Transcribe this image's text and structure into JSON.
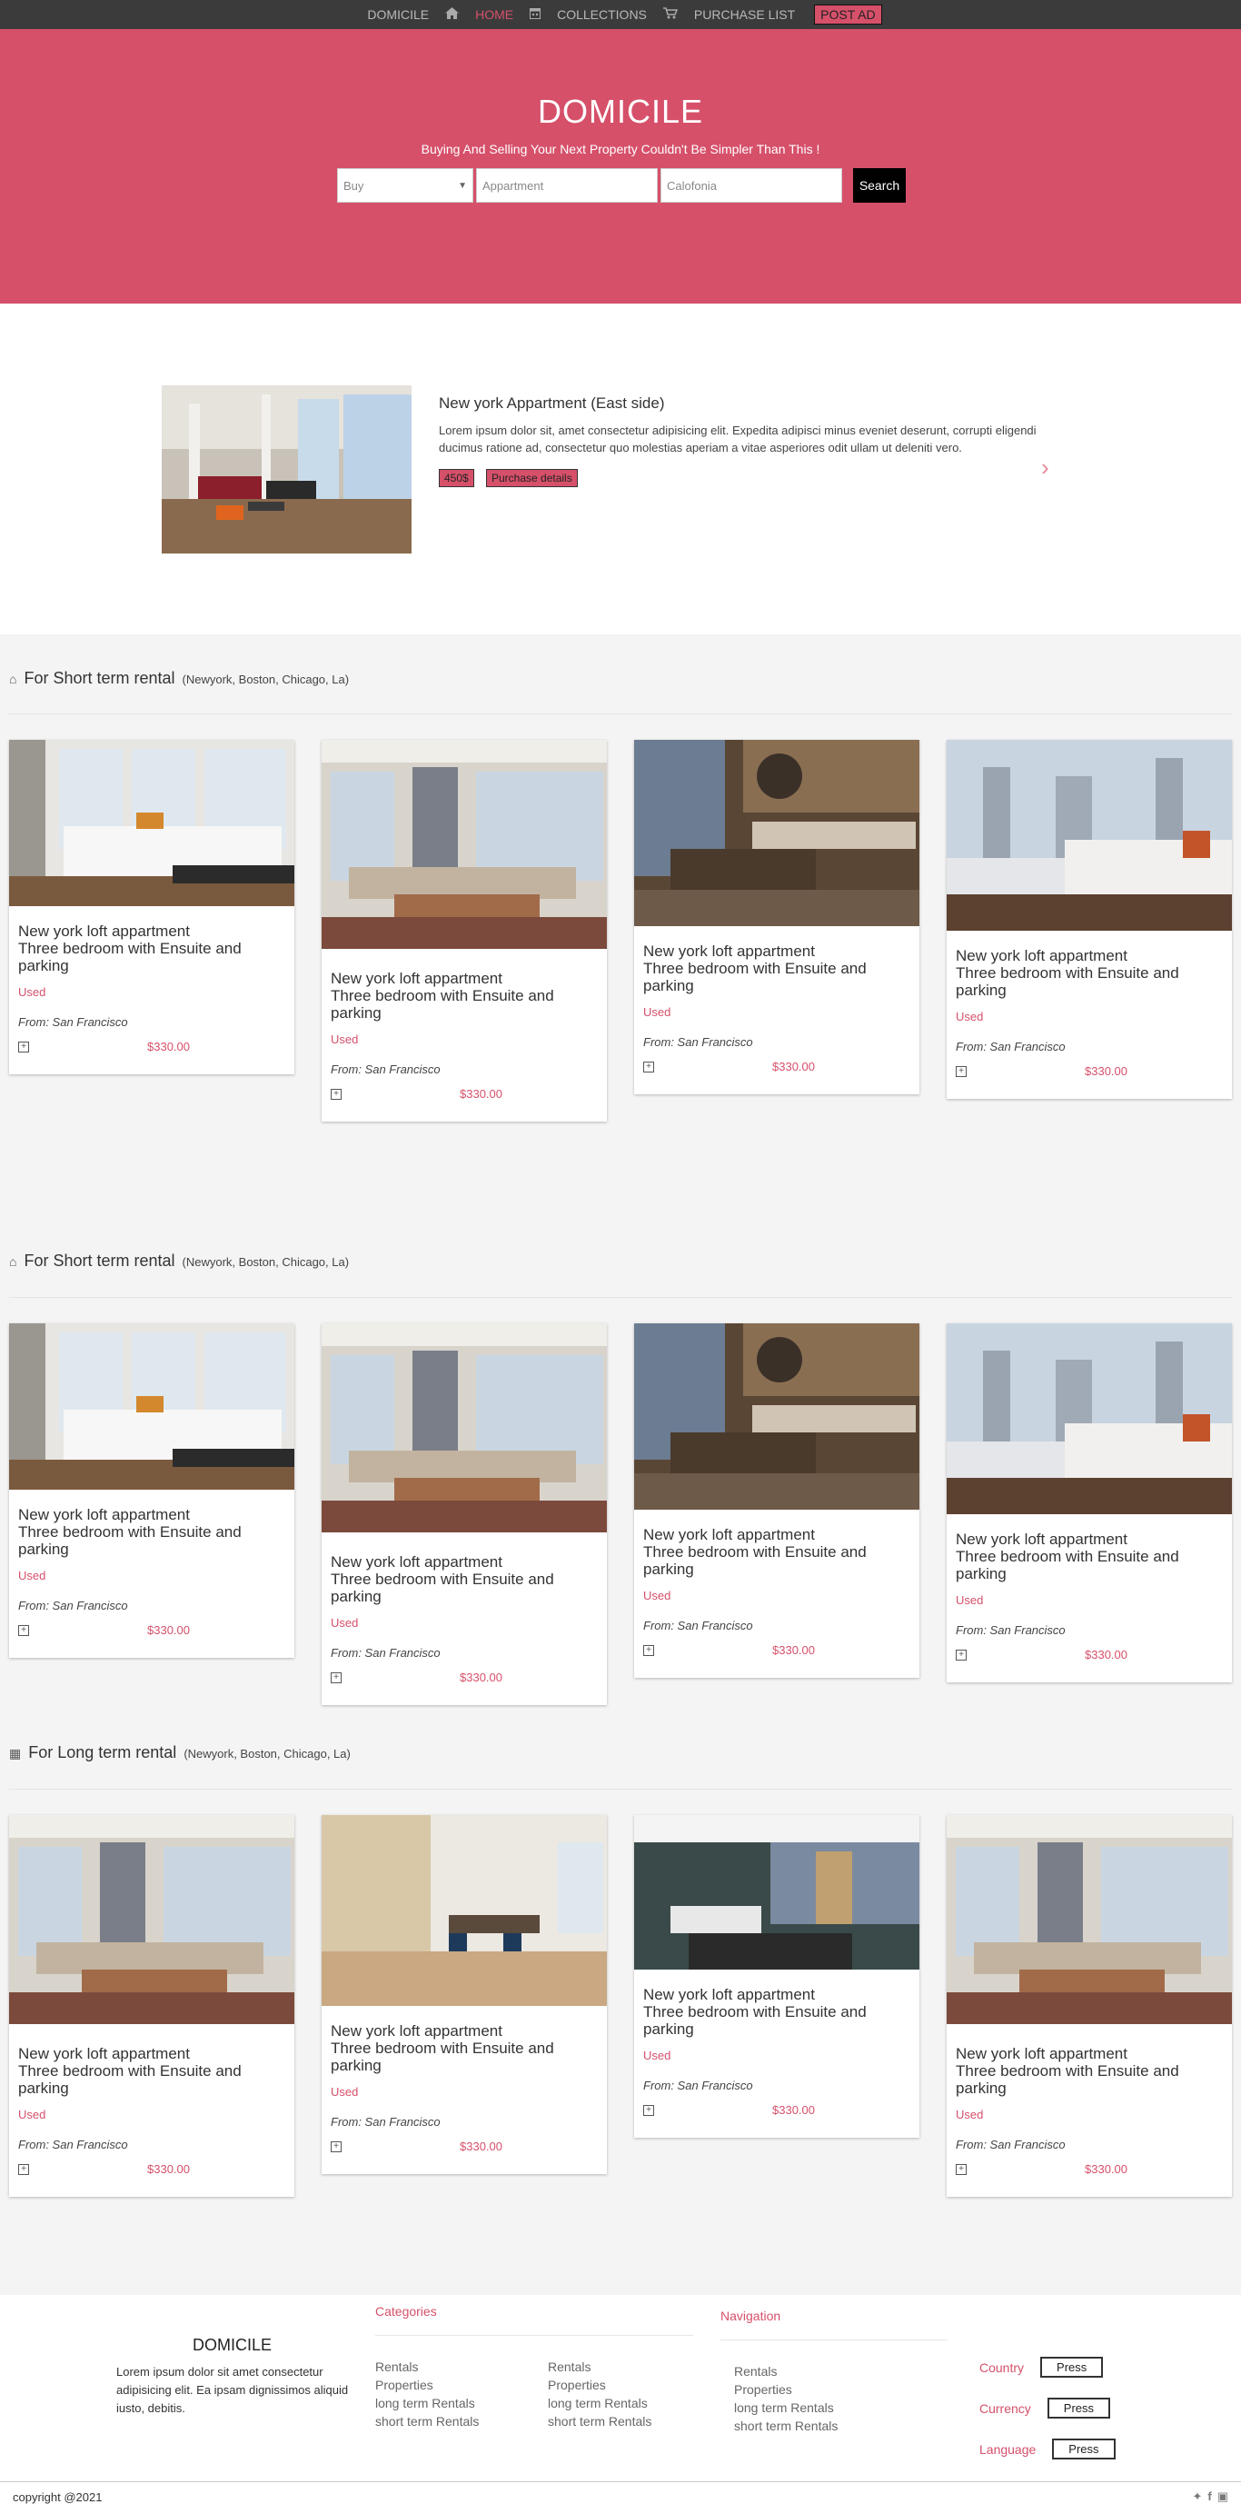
{
  "nav": {
    "brand": "DOMICILE",
    "home": "HOME",
    "collections": "COLLECTIONS",
    "purchase_list": "PURCHASE LIST",
    "post_ad": "POST AD"
  },
  "hero": {
    "title": "DOMICILE",
    "subtitle": "Buying And Selling Your Next Property Couldn't Be Simpler Than This !",
    "type_value": "Buy",
    "property_value": "Appartment",
    "location_value": "Calofonia",
    "search_label": "Search"
  },
  "featured": {
    "title": "New york Appartment (East side)",
    "description": "Lorem ipsum dolor sit, amet consectetur adipisicing elit. Expedita adipisci minus eveniet deserunt, corrupti eligendi ducimus ratione ad, consectetur quo molestias aperiam a vitae asperiores odit ullam ut deleniti vero.",
    "price_tag": "450$",
    "details_label": "Purchase details"
  },
  "sections": [
    {
      "title": "For Short term rental",
      "subtitle": "(Newyork, Boston, Chicago, La)"
    },
    {
      "title": "For Short term rental",
      "subtitle": "(Newyork, Boston, Chicago, La)"
    },
    {
      "title": "For Long term rental",
      "subtitle": "(Newyork, Boston, Chicago, La)"
    }
  ],
  "card": {
    "title_line1": "New york loft appartment",
    "title_line2": "Three bedroom with Ensuite and parking",
    "condition": "Used",
    "from": "From: San Francisco",
    "price": "$330.00"
  },
  "footer": {
    "brand": "DOMICILE",
    "about": "Lorem ipsum dolor sit amet consectetur adipisicing elit. Ea ipsam dignissimos aliquid iusto, debitis.",
    "categories_heading": "Categories",
    "categories_col1": [
      "Rentals",
      "Properties",
      "long term Rentals",
      "short term Rentals"
    ],
    "categories_col2": [
      "Rentals",
      "Properties",
      "long term Rentals",
      "short term Rentals"
    ],
    "navigation_heading": "Navigation",
    "navigation_links": [
      "Rentals",
      "Properties",
      "long term Rentals",
      "short term Rentals"
    ],
    "country_label": "Country",
    "currency_label": "Currency",
    "language_label": "Language",
    "press_label": "Press",
    "copyright": "copyright @2021"
  },
  "colors": {
    "accent": "#d6506a",
    "nav_bg": "#3b3b3b"
  }
}
